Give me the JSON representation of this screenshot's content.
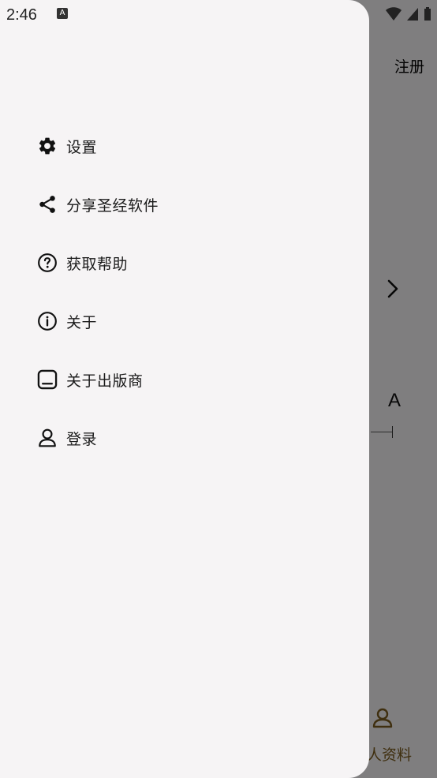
{
  "status_bar": {
    "time": "2:46",
    "notification_icon_letter": "A"
  },
  "background": {
    "register_label": "注册",
    "font_size_letter": "A",
    "profile_tab_label": "人资料",
    "profile_tab_color": "#7a5a1e"
  },
  "drawer": {
    "menu": [
      {
        "label": "设置",
        "icon": "gear-icon"
      },
      {
        "label": "分享圣经软件",
        "icon": "share-icon"
      },
      {
        "label": "获取帮助",
        "icon": "help-circle-icon"
      },
      {
        "label": "关于",
        "icon": "info-circle-icon"
      },
      {
        "label": "关于出版商",
        "icon": "publisher-icon"
      },
      {
        "label": "登录",
        "icon": "user-icon"
      }
    ]
  }
}
